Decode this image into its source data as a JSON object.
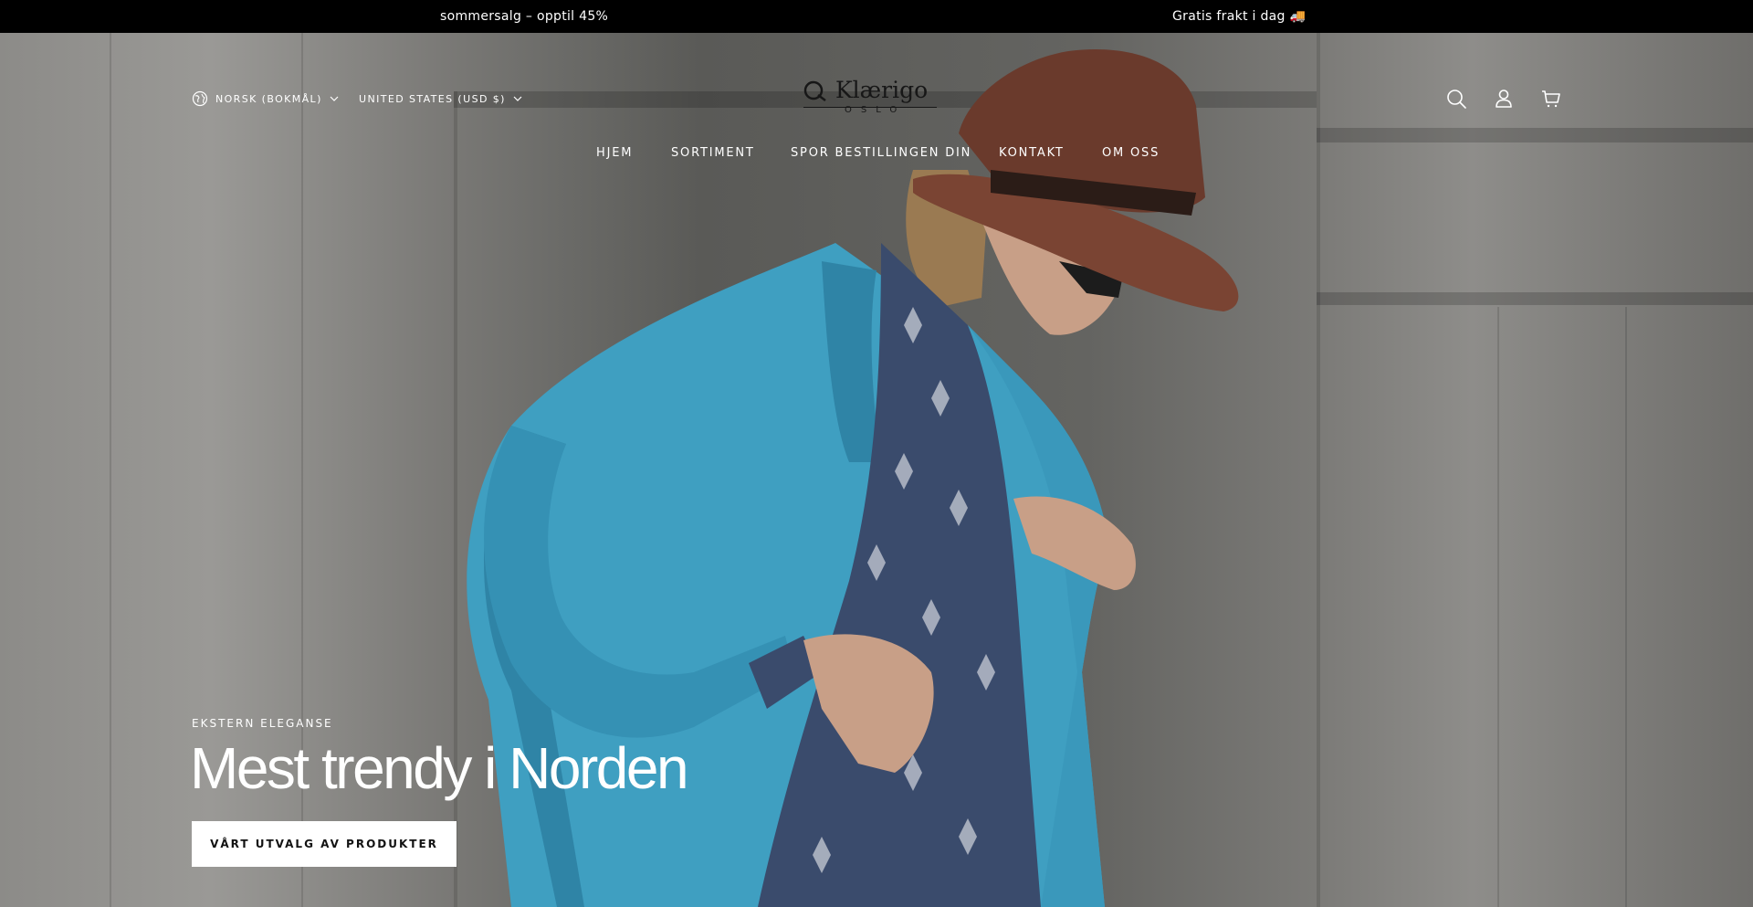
{
  "announcement": {
    "left_text": "sommersalg – opptil 45%",
    "right_text": "Gratis frakt i dag 🚚"
  },
  "header": {
    "language": "Norsk (Bokmål)",
    "currency": "United States (USD $)",
    "logo": {
      "name": "Klærigo",
      "subtitle": "OSLO"
    },
    "icons": [
      "search-icon",
      "account-icon",
      "cart-icon"
    ]
  },
  "nav": {
    "items": [
      {
        "label": "HJEM"
      },
      {
        "label": "SORTIMENT"
      },
      {
        "label": "SPOR BESTILLINGEN DIN"
      },
      {
        "label": "KONTAKT"
      },
      {
        "label": "OM OSS"
      }
    ]
  },
  "hero": {
    "eyebrow": "EKSTERN ELEGANSE",
    "headline": "Mest trendy i Norden",
    "cta_label": "VÅRT UTVALG AV PRODUKTER"
  },
  "colors": {
    "announcement_bg": "#000000",
    "text_on_hero": "#ffffff",
    "cta_bg": "#ffffff",
    "cta_text": "#121212",
    "jacket": "#3f9fc1",
    "hat": "#6a3a2c"
  }
}
